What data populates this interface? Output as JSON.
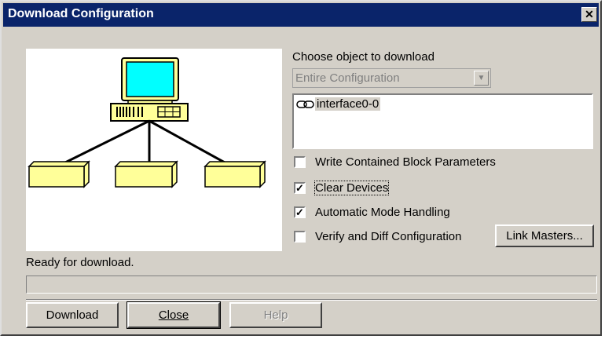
{
  "window": {
    "title": "Download Configuration",
    "close_glyph": "✕"
  },
  "object_panel": {
    "label": "Choose object to download",
    "combo_value": "Entire Configuration",
    "list_items": [
      {
        "icon": "network-link-icon",
        "label": "interface0-0"
      }
    ]
  },
  "options": [
    {
      "label": "Write Contained Block Parameters",
      "checked": false
    },
    {
      "label": "Clear Devices",
      "checked": true
    },
    {
      "label": "Automatic Mode Handling",
      "checked": true
    },
    {
      "label": "Verify and Diff Configuration",
      "checked": false
    }
  ],
  "buttons": {
    "link_masters": "Link Masters...",
    "download": "Download",
    "close": "Close",
    "help": "Help"
  },
  "status": {
    "text": "Ready for download.",
    "progress": 0
  },
  "colors": {
    "titlebar": "#0a246a",
    "dialog_face": "#d4d0c8",
    "monitor_screen": "#00ffff",
    "device_fill": "#ffff99"
  }
}
